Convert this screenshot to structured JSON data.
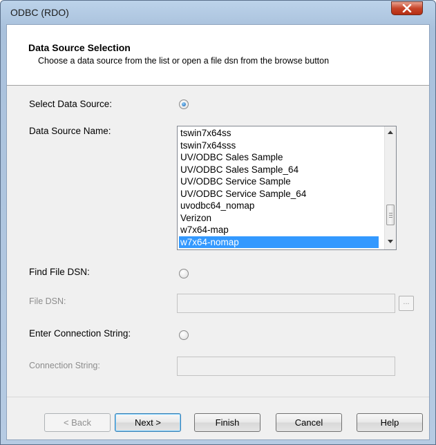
{
  "window": {
    "title": "ODBC (RDO)"
  },
  "header": {
    "title": "Data Source Selection",
    "description": "Choose a data source from the list or open a file dsn from the browse button"
  },
  "form": {
    "select_data_source_label": "Select Data Source:",
    "data_source_name_label": "Data Source Name:",
    "find_file_dsn_label": "Find File DSN:",
    "file_dsn_label": "File DSN:",
    "enter_connection_string_label": "Enter Connection String:",
    "connection_string_label": "Connection String:",
    "file_dsn_value": "",
    "connection_string_value": "",
    "browse_label": "..."
  },
  "data_sources": {
    "items": [
      "tswin7x64ss",
      "tswin7x64sss",
      "UV/ODBC Sales Sample",
      "UV/ODBC Sales Sample_64",
      "UV/ODBC Service Sample",
      "UV/ODBC Service Sample_64",
      "uvodbc64_nomap",
      "Verizon",
      "w7x64-map",
      "w7x64-nomap"
    ],
    "selected": "w7x64-nomap"
  },
  "buttons": {
    "back": "< Back",
    "next": "Next >",
    "finish": "Finish",
    "cancel": "Cancel",
    "help": "Help"
  },
  "colors": {
    "selection": "#3399ff",
    "close_button": "#c7452a"
  }
}
